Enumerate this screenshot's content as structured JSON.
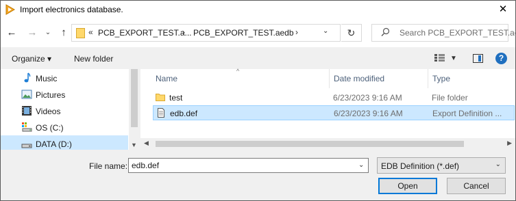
{
  "window": {
    "title": "Import electronics database.",
    "close_glyph": "✕"
  },
  "nav": {
    "back_glyph": "←",
    "forward_glyph": "→",
    "recent_glyph": "⌄",
    "up_glyph": "↑",
    "breadcrumb_overflow": "«",
    "breadcrumb": [
      "PCB_EXPORT_TEST.a...",
      "PCB_EXPORT_TEST.aedb"
    ],
    "crumb_sep": "›",
    "refresh_glyph": "↻",
    "search_placeholder": "Search PCB_EXPORT_TEST.ae..."
  },
  "toolbar": {
    "organize_label": "Organize ▾",
    "new_folder_label": "New folder",
    "help_glyph": "?"
  },
  "sidebar": {
    "items": [
      {
        "label": "Music",
        "icon": "music-icon",
        "selected": false
      },
      {
        "label": "Pictures",
        "icon": "pictures-icon",
        "selected": false
      },
      {
        "label": "Videos",
        "icon": "videos-icon",
        "selected": false
      },
      {
        "label": "OS (C:)",
        "icon": "os-drive-icon",
        "selected": false
      },
      {
        "label": "DATA (D:)",
        "icon": "drive-icon",
        "selected": true
      }
    ]
  },
  "files": {
    "columns": [
      "Name",
      "Date modified",
      "Type"
    ],
    "rows": [
      {
        "name": "test",
        "date": "6/23/2023 9:16 AM",
        "type": "File folder",
        "icon": "folder-icon",
        "selected": false
      },
      {
        "name": "edb.def",
        "date": "6/23/2023 9:16 AM",
        "type": "Export Definition ...",
        "icon": "file-icon",
        "selected": true
      }
    ]
  },
  "footer": {
    "file_name_label": "File name:",
    "file_name_value": "edb.def",
    "filter_value": "EDB Definition (*.def)",
    "open_label": "Open",
    "cancel_label": "Cancel"
  },
  "colors": {
    "selection": "#cce8ff",
    "selection_border": "#99d1ff",
    "accent": "#0078d7",
    "folder": "#ffd86b"
  }
}
